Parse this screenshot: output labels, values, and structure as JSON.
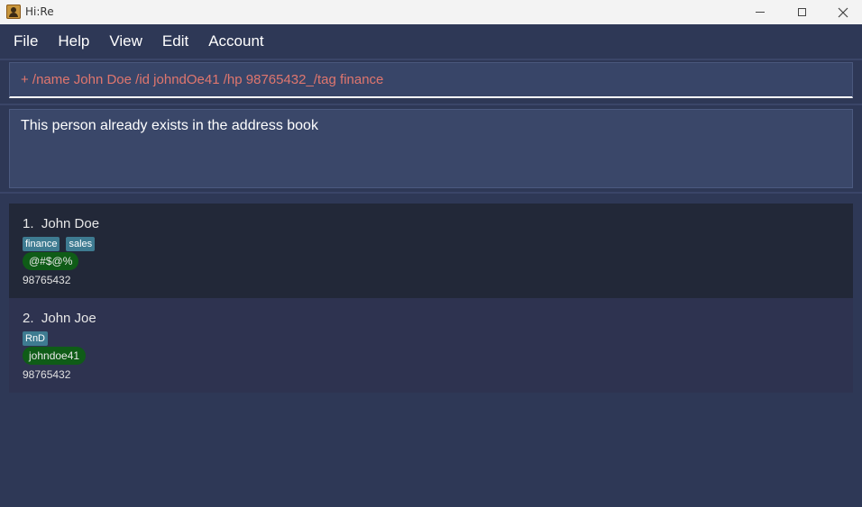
{
  "window": {
    "title": "Hi:Re",
    "icon": "app-icon"
  },
  "menu": {
    "items": [
      "File",
      "Help",
      "View",
      "Edit",
      "Account"
    ]
  },
  "command": {
    "value": "+ /name John Doe /id johndOe41 /hp 98765432_/tag finance"
  },
  "result": {
    "message": "This person already exists in the address book"
  },
  "persons": [
    {
      "index": "1.",
      "name": "John Doe",
      "tags": [
        "finance",
        "sales"
      ],
      "handle": "@#$@%",
      "phone": "98765432"
    },
    {
      "index": "2.",
      "name": "John Joe",
      "tags": [
        "RnD"
      ],
      "handle": "johndoe41",
      "phone": "98765432"
    }
  ],
  "colors": {
    "background": "#2e3856",
    "command_text": "#e0766e",
    "tag": "#3e7b91",
    "handle": "#0f5c17",
    "card_odd": "#222838",
    "card_even": "#2e3350"
  }
}
